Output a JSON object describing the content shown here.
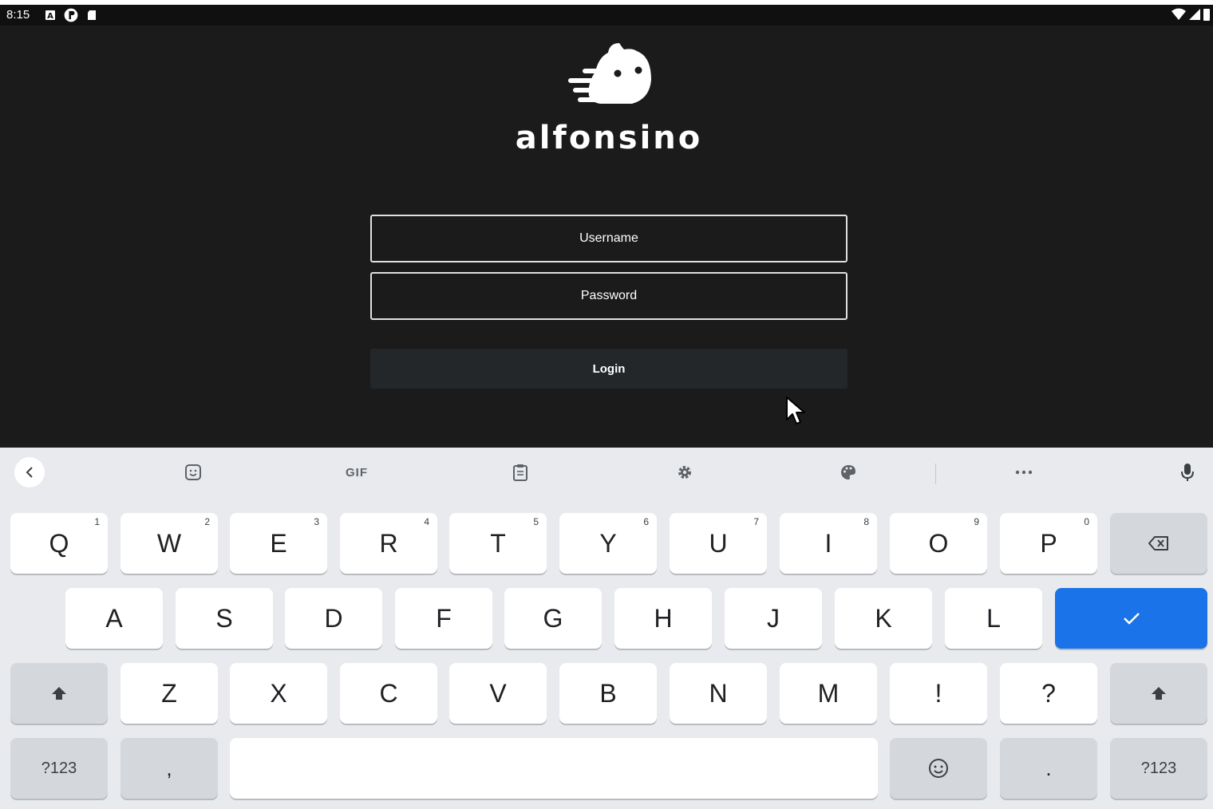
{
  "status_bar": {
    "time": "8:15",
    "left_icons": [
      "text-a-icon",
      "circle-p-icon",
      "sd-card-icon"
    ],
    "right_icons": [
      "wifi-icon",
      "signal-icon",
      "battery-icon"
    ]
  },
  "app": {
    "brand_name": "alfonsino",
    "username_placeholder": "Username",
    "password_placeholder": "Password",
    "login_label": "Login"
  },
  "keyboard": {
    "toolbar": {
      "gif_label": "GIF",
      "icons": [
        "chevron-left-icon",
        "sticker-icon",
        "gif-icon",
        "clipboard-icon",
        "gear-icon",
        "palette-icon",
        "more-icon",
        "microphone-icon"
      ]
    },
    "row1": [
      {
        "label": "Q",
        "hint": "1"
      },
      {
        "label": "W",
        "hint": "2"
      },
      {
        "label": "E",
        "hint": "3"
      },
      {
        "label": "R",
        "hint": "4"
      },
      {
        "label": "T",
        "hint": "5"
      },
      {
        "label": "Y",
        "hint": "6"
      },
      {
        "label": "U",
        "hint": "7"
      },
      {
        "label": "I",
        "hint": "8"
      },
      {
        "label": "O",
        "hint": "9"
      },
      {
        "label": "P",
        "hint": "0"
      }
    ],
    "row2": [
      "A",
      "S",
      "D",
      "F",
      "G",
      "H",
      "J",
      "K",
      "L"
    ],
    "row3": [
      "Z",
      "X",
      "C",
      "V",
      "B",
      "N",
      "M",
      "!",
      "?"
    ],
    "row4": {
      "symbols_label": "?123",
      "comma": ",",
      "period": ".",
      "symbols_label_right": "?123"
    },
    "colors": {
      "action_key": "#1a73e8",
      "key_background": "#ffffff",
      "function_key": "#d4d7dc",
      "keyboard_background": "#e8eaed"
    }
  }
}
